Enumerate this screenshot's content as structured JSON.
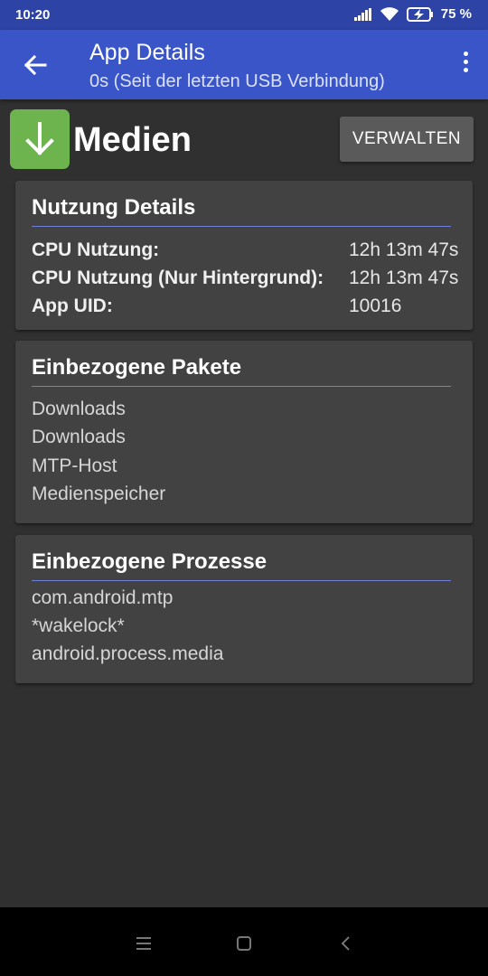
{
  "status_bar": {
    "time": "10:20",
    "battery": "75 %"
  },
  "app_bar": {
    "title": "App Details",
    "subtitle": "0s (Seit der letzten USB Verbindung)"
  },
  "app": {
    "name": "Medien",
    "manage_label": "VERWALTEN",
    "icon_color": "#6db44e"
  },
  "usage": {
    "title": "Nutzung Details",
    "rows": [
      {
        "label": "CPU Nutzung:",
        "value": "12h 13m 47s"
      },
      {
        "label": "CPU Nutzung (Nur Hintergrund):",
        "value": "12h 13m 47s"
      },
      {
        "label": "App UID:",
        "value": "10016"
      }
    ]
  },
  "packages": {
    "title": "Einbezogene Pakete",
    "items": [
      "Downloads",
      "Downloads",
      "MTP-Host",
      "Medienspeicher"
    ]
  },
  "processes": {
    "title": "Einbezogene Prozesse",
    "items": [
      "com.android.mtp",
      "*wakelock*",
      "android.process.media"
    ]
  },
  "colors": {
    "accent": "#3a55c8",
    "status_bar": "#2d44a6",
    "background": "#303030",
    "card": "#424242"
  }
}
